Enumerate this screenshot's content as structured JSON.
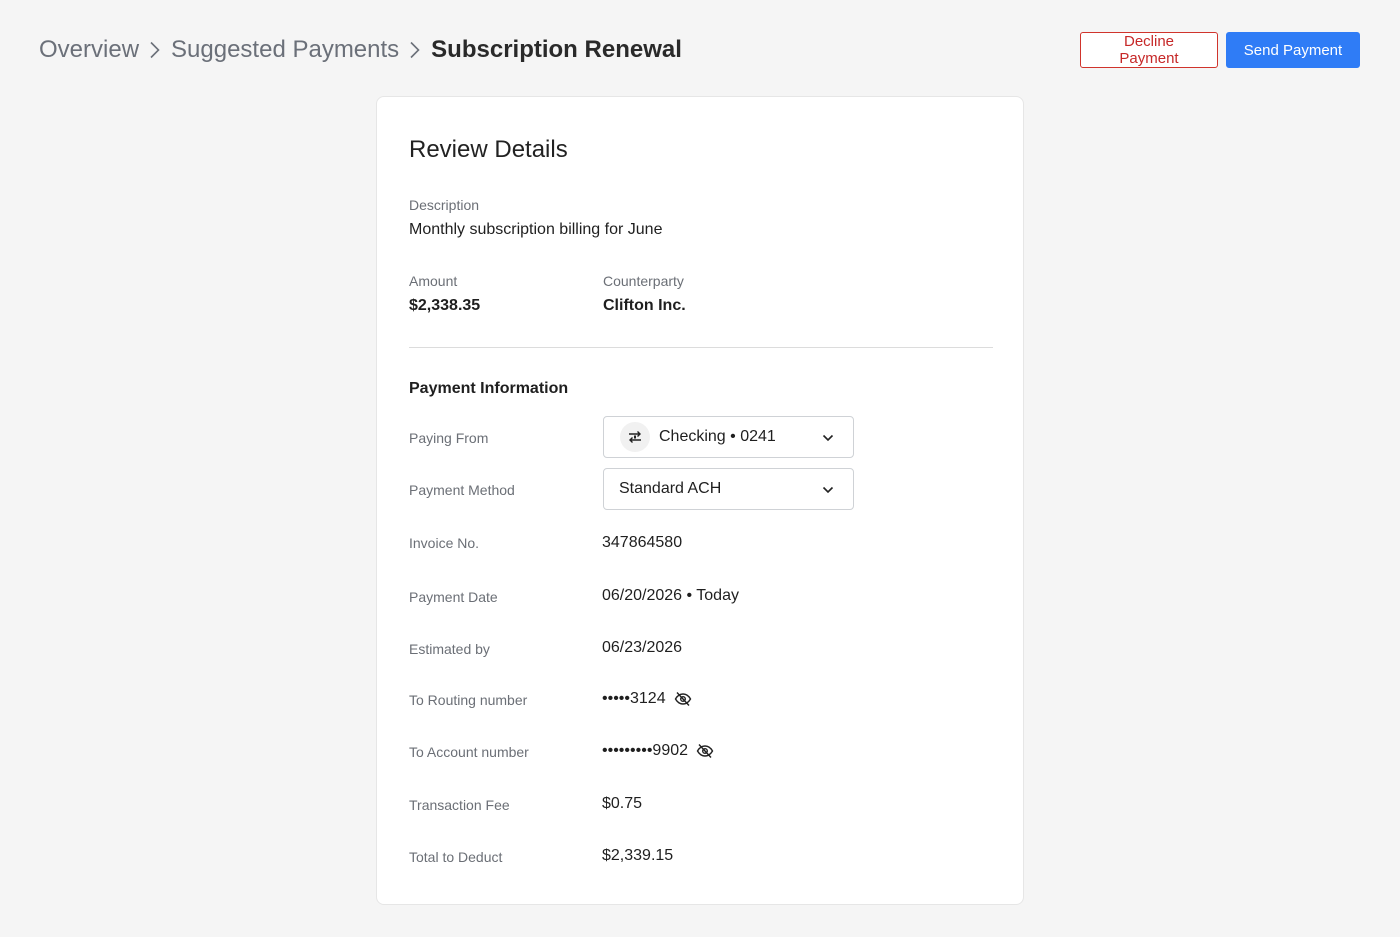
{
  "breadcrumb": {
    "items": [
      "Overview",
      "Suggested Payments"
    ],
    "current": "Subscription Renewal"
  },
  "actions": {
    "decline_label": "Decline Payment",
    "send_label": "Send Payment"
  },
  "colors": {
    "primary": "#2f7cf6",
    "danger": "#c62828",
    "background": "#f5f5f5"
  },
  "review": {
    "title": "Review Details",
    "description_label": "Description",
    "description_value": "Monthly subscription billing for June",
    "amount_label": "Amount",
    "amount_value": "$2,338.35",
    "counterparty_label": "Counterparty",
    "counterparty_value": "Clifton Inc."
  },
  "payment_info": {
    "title": "Payment Information",
    "paying_from_label": "Paying From",
    "paying_from_value": "Checking • 0241",
    "paying_from_icon": "bank-transfer-icon",
    "method_label": "Payment Method",
    "method_value": "Standard ACH",
    "invoice_label": "Invoice No.",
    "invoice_value": "347864580",
    "date_label": "Payment Date",
    "date_value": "06/20/2026 • Today",
    "estimated_label": "Estimated by",
    "estimated_value": "06/23/2026",
    "routing_label": "To Routing number",
    "routing_value": "•••••3124",
    "account_label": "To Account number",
    "account_value": "•••••••••9902",
    "fee_label": "Transaction Fee",
    "fee_value": "$0.75",
    "total_label": "Total to Deduct",
    "total_value": "$2,339.15"
  }
}
